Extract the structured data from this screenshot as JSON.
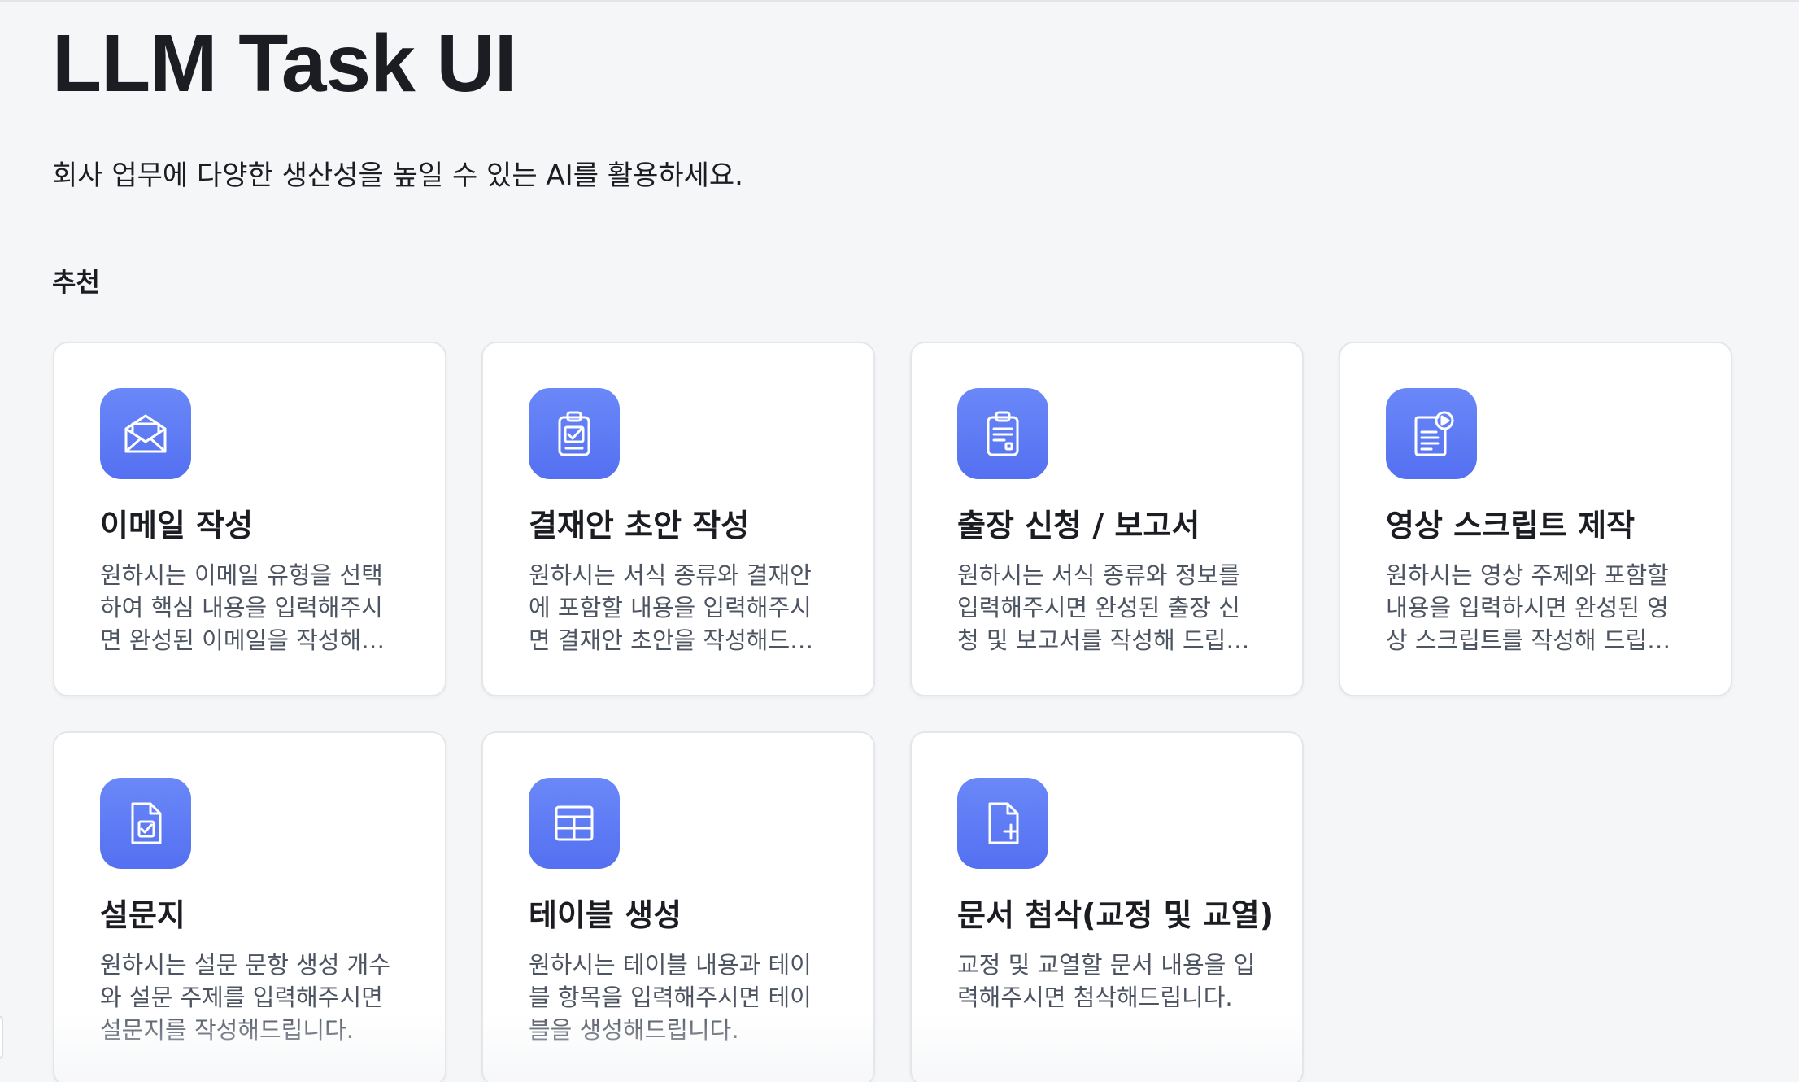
{
  "header": {
    "title": "LLM Task UI",
    "subtitle": "회사 업무에 다양한 생산성을 높일 수 있는 AI를 활용하세요."
  },
  "section": {
    "label": "추천"
  },
  "cards": [
    {
      "title": "이메일 작성",
      "description": "원하시는 이메일 유형을 선택하여 핵심 내용을 입력해주시면 완성된 이메일을 작성해드립니다.",
      "icon": "envelope-icon"
    },
    {
      "title": "결재안 초안 작성",
      "description": "원하시는 서식 종류와 결재안에 포함할 내용을 입력해주시면 결재안 초안을 작성해드립니다.",
      "icon": "clipboard-check-icon"
    },
    {
      "title": "출장 신청 / 보고서",
      "description": "원하시는 서식 종류와 정보를 입력해주시면 완성된 출장 신청 및 보고서를 작성해 드립니다.",
      "icon": "clipboard-list-icon"
    },
    {
      "title": "영상 스크립트 제작",
      "description": "원하시는 영상 주제와 포함할 내용을 입력하시면 완성된 영상 스크립트를 작성해 드립니다.",
      "icon": "document-play-icon"
    },
    {
      "title": "설문지",
      "description": "원하시는 설문 문항 생성 개수와 설문 주제를 입력해주시면 설문지를 작성해드립니다.",
      "icon": "document-check-icon"
    },
    {
      "title": "테이블 생성",
      "description": "원하시는 테이블 내용과 테이블 항목을 입력해주시면 테이블을 생성해드립니다.",
      "icon": "table-icon"
    },
    {
      "title": "문서 첨삭(교정 및 교열)",
      "description": "교정 및 교열할 문서 내용을 입력해주시면 첨삭해드립니다.",
      "icon": "document-plus-icon"
    }
  ],
  "colors": {
    "accent_top": "#6a88f8",
    "accent_bottom": "#5470f1",
    "background": "#f5f6f8",
    "card": "#ffffff",
    "text_primary": "#1b1d22",
    "text_secondary": "#4e5562"
  }
}
